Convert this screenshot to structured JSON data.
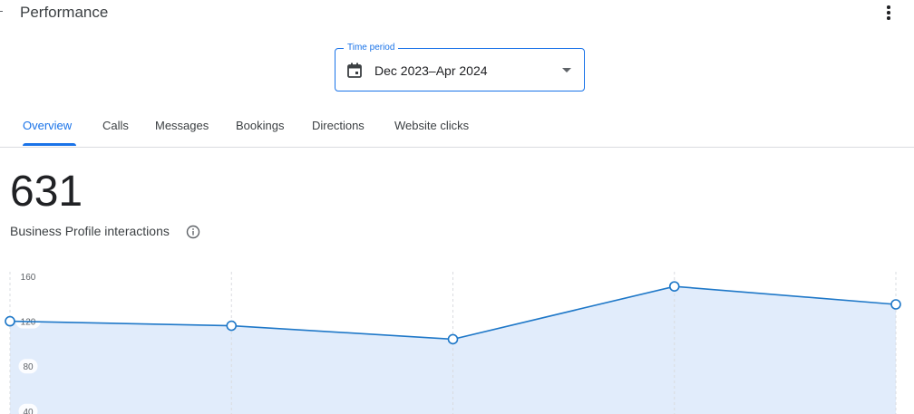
{
  "header": {
    "title": "Performance",
    "back_icon": "back-arrow-icon",
    "menu_icon": "more-vert-icon"
  },
  "period": {
    "label": "Time period",
    "value": "Dec 2023–Apr 2024",
    "icon": "calendar-icon",
    "accent": "#1a73e8"
  },
  "tabs": [
    {
      "label": "Overview",
      "active": true
    },
    {
      "label": "Calls",
      "active": false
    },
    {
      "label": "Messages",
      "active": false
    },
    {
      "label": "Bookings",
      "active": false
    },
    {
      "label": "Directions",
      "active": false
    },
    {
      "label": "Website clicks",
      "active": false
    }
  ],
  "summary": {
    "total": "631",
    "label": "Business Profile interactions",
    "info_icon": "info-icon"
  },
  "chart_data": {
    "type": "area",
    "x": [
      0,
      1,
      2,
      3,
      4
    ],
    "series": [
      {
        "values": [
          120,
          116,
          104,
          151,
          135
        ],
        "color": "#1f78c8",
        "fill": "#e1ecfb"
      }
    ],
    "yticks": [
      160,
      120,
      80,
      40
    ],
    "ylim": [
      0,
      160
    ],
    "grid": "vertical-dashed"
  }
}
